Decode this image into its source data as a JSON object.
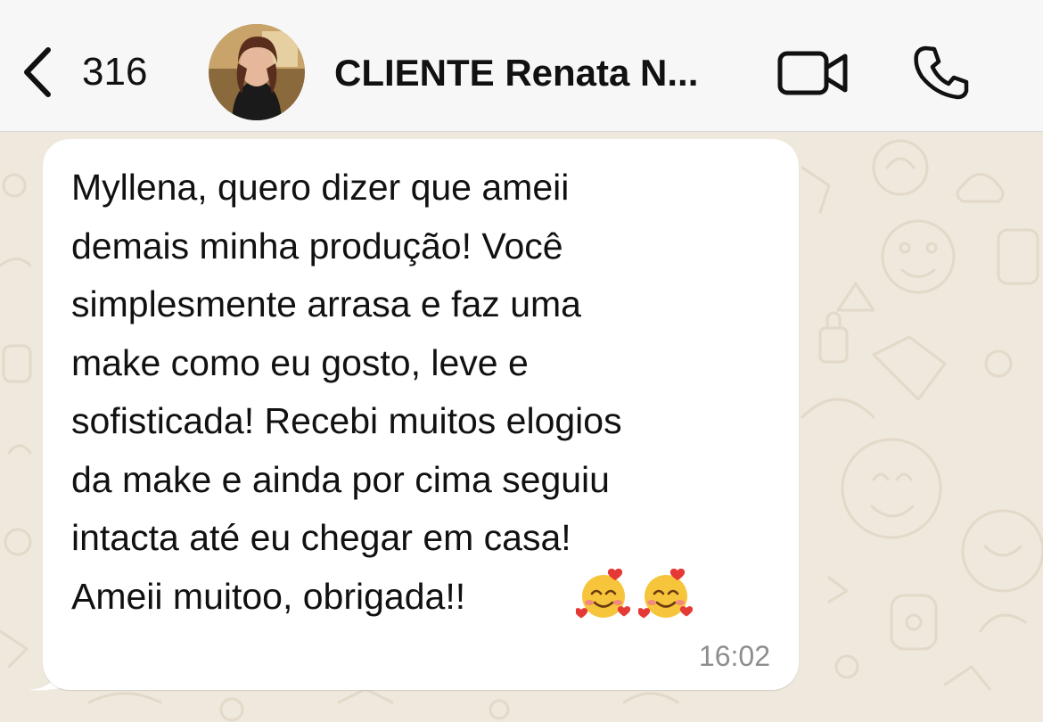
{
  "header": {
    "back_count": "316",
    "contact_name": "CLIENTE Renata N...",
    "icons": {
      "back": "chevron-left-icon",
      "video": "video-camera-icon",
      "call": "phone-icon"
    }
  },
  "message": {
    "text": "Myllena, quero dizer que ameii\ndemais minha produção! Você\nsimplesmente arrasa e faz uma\nmake como eu gosto, leve e\nsofisticada! Recebi muitos elogios\nda make e ainda por cima seguiu\nintacta até eu chegar em casa!\nAmeii muitoo, obrigada!!",
    "emojis": [
      "smiling-face-with-hearts",
      "smiling-face-with-hearts"
    ],
    "time": "16:02"
  },
  "colors": {
    "header_bg": "#f7f7f7",
    "wallpaper_bg": "#efe8dc",
    "bubble_bg": "#ffffff",
    "text": "#111111",
    "timestamp": "#8e8e8e"
  }
}
